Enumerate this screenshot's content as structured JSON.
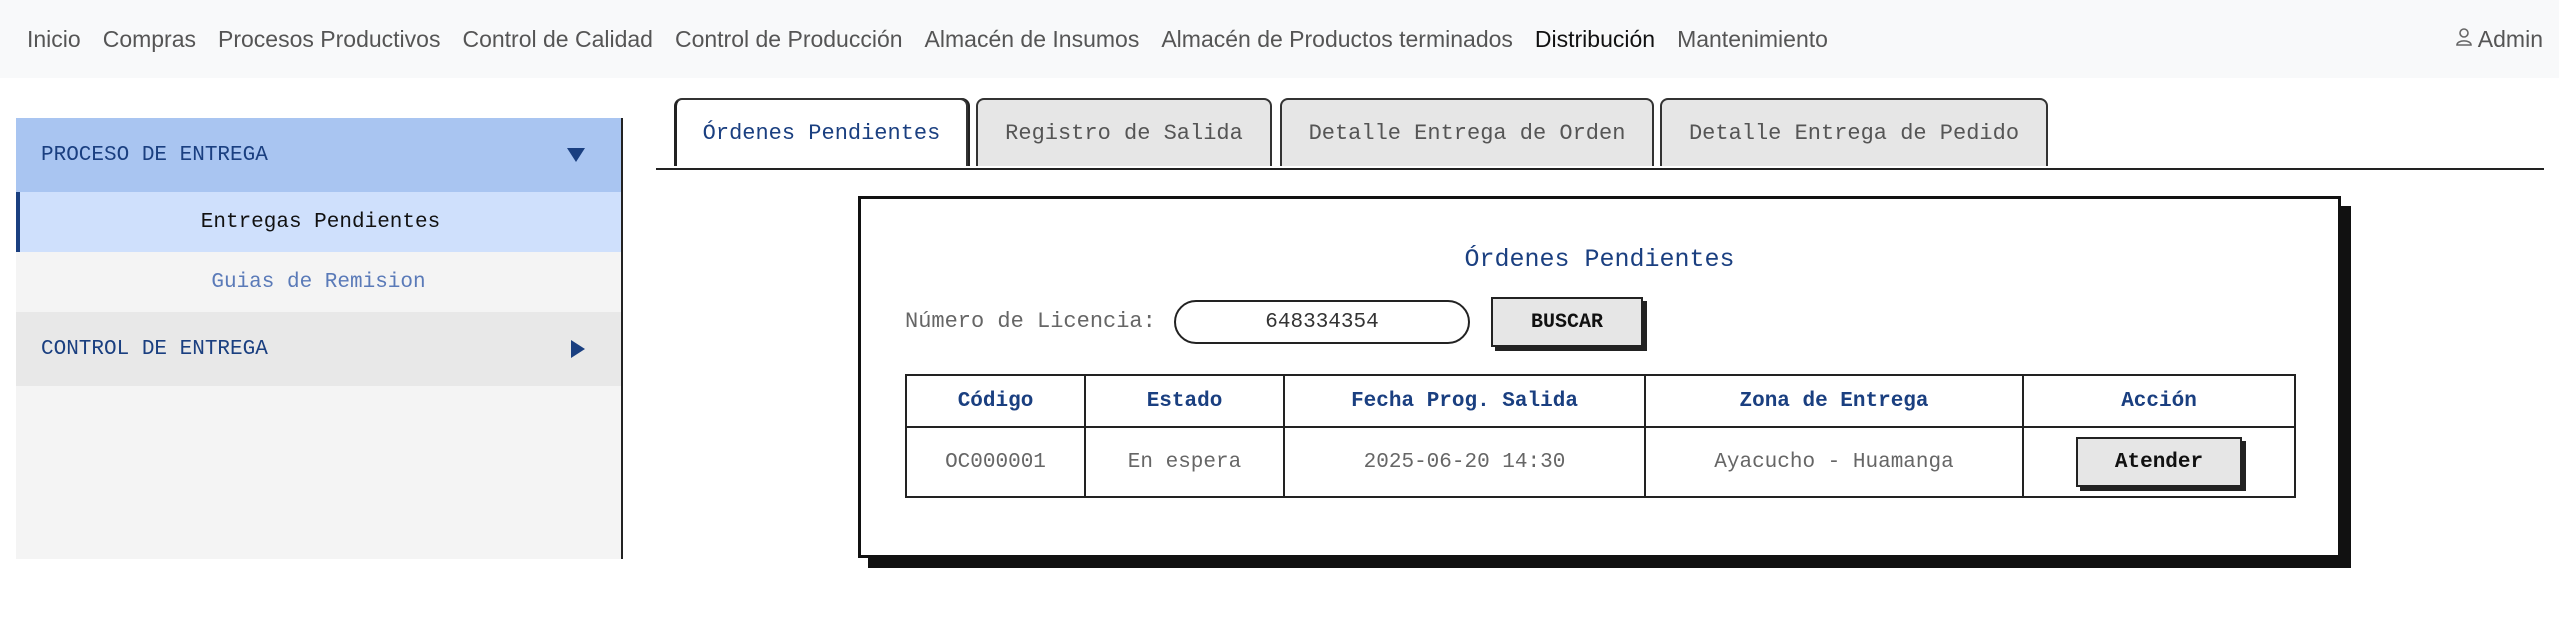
{
  "navbar": {
    "items": [
      {
        "label": "Inicio"
      },
      {
        "label": "Compras"
      },
      {
        "label": "Procesos Productivos"
      },
      {
        "label": "Control de Calidad"
      },
      {
        "label": "Control de Producción"
      },
      {
        "label": "Almacén de Insumos"
      },
      {
        "label": "Almacén de Productos terminados"
      },
      {
        "label": "Distribución",
        "active": true
      },
      {
        "label": "Mantenimiento"
      }
    ],
    "user_label": "Admin",
    "user_icon": "user-icon"
  },
  "sidebar": {
    "sections": [
      {
        "label": "PROCESO DE ENTREGA",
        "expanded": true,
        "arrow_icon": "triangle-down-icon",
        "items": [
          {
            "label": "Entregas Pendientes",
            "active": true
          },
          {
            "label": "Guias de Remision",
            "active": false
          }
        ]
      },
      {
        "label": "CONTROL DE ENTREGA",
        "expanded": false,
        "arrow_icon": "triangle-right-icon",
        "items": []
      }
    ]
  },
  "tabs": [
    {
      "label": "Órdenes Pendientes",
      "active": true
    },
    {
      "label": "Registro de Salida",
      "active": false
    },
    {
      "label": "Detalle Entrega de Orden",
      "active": false
    },
    {
      "label": "Detalle Entrega de Pedido",
      "active": false
    }
  ],
  "panel": {
    "title": "Órdenes Pendientes",
    "license_label": "Número de Licencia:",
    "license_value": "648334354",
    "search_button": "BUSCAR",
    "table": {
      "columns": [
        "Código",
        "Estado",
        "Fecha Prog. Salida",
        "Zona de Entrega",
        "Acción"
      ],
      "rows": [
        {
          "codigo": "OC000001",
          "estado": "En espera",
          "fecha": "2025-06-20 14:30",
          "zona": "Ayacucho - Huamanga",
          "accion": "Atender"
        }
      ]
    }
  },
  "colors": {
    "accent": "#1a3f80",
    "sidebar_open": "#a9c5f1",
    "sidebar_active_item": "#cfe0fc",
    "navbar_bg": "#f8f9fa"
  }
}
